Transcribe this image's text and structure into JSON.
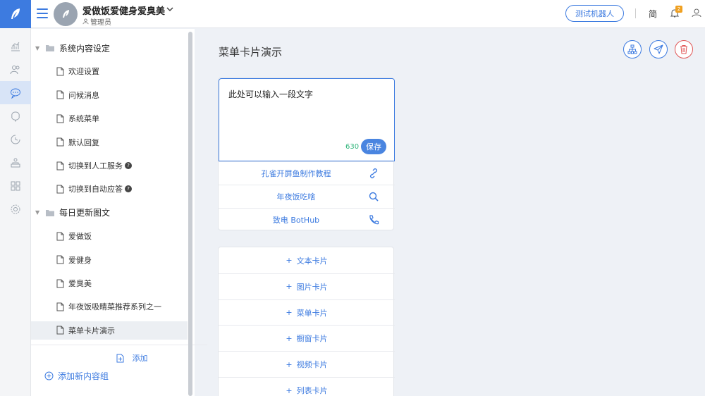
{
  "header": {
    "app_title": "爱做饭爱健身爱臭美",
    "user_role": "管理员",
    "bot_button": "测试机器人",
    "lang_toggle": "简",
    "notification_count": "2"
  },
  "rail": {
    "icons": [
      "chart-icon",
      "users-icon",
      "chat-icon",
      "brain-icon",
      "history-icon",
      "team-icon",
      "apps-icon",
      "settings-icon"
    ],
    "active_index": 2
  },
  "tree": {
    "groups": [
      {
        "label": "系统内容设定",
        "items": [
          {
            "label": "欢迎设置",
            "help": false
          },
          {
            "label": "问候消息",
            "help": false
          },
          {
            "label": "系统菜单",
            "help": false
          },
          {
            "label": "默认回复",
            "help": false
          },
          {
            "label": "切换到人工服务",
            "help": true
          },
          {
            "label": "切换到自动应答",
            "help": true
          }
        ]
      },
      {
        "label": "每日更新图文",
        "items": [
          {
            "label": "爱做饭",
            "help": false
          },
          {
            "label": "爱健身",
            "help": false
          },
          {
            "label": "爱臭美",
            "help": false
          },
          {
            "label": "年夜饭吸睛菜推荐系列之一",
            "help": false
          },
          {
            "label": "菜单卡片演示",
            "help": false
          }
        ]
      }
    ],
    "selected_item": "菜单卡片演示",
    "add_label": "添加",
    "add_group_label": "添加新内容组"
  },
  "main": {
    "title": "菜单卡片演示",
    "editor": {
      "text": "此处可以输入一段文字",
      "char_count": "630",
      "save_label": "保存"
    },
    "menu_items": [
      {
        "label": "孔雀开屏鱼制作教程",
        "icon": "link-icon"
      },
      {
        "label": "年夜饭吃啥",
        "icon": "search-icon"
      },
      {
        "label": "致电 BotHub",
        "icon": "phone-icon"
      }
    ],
    "add_cards": [
      "文本卡片",
      "图片卡片",
      "菜单卡片",
      "橱窗卡片",
      "视频卡片",
      "列表卡片"
    ],
    "colors": {
      "accent": "#3d7be0",
      "danger": "#e05555",
      "count": "#2fb57a"
    }
  }
}
